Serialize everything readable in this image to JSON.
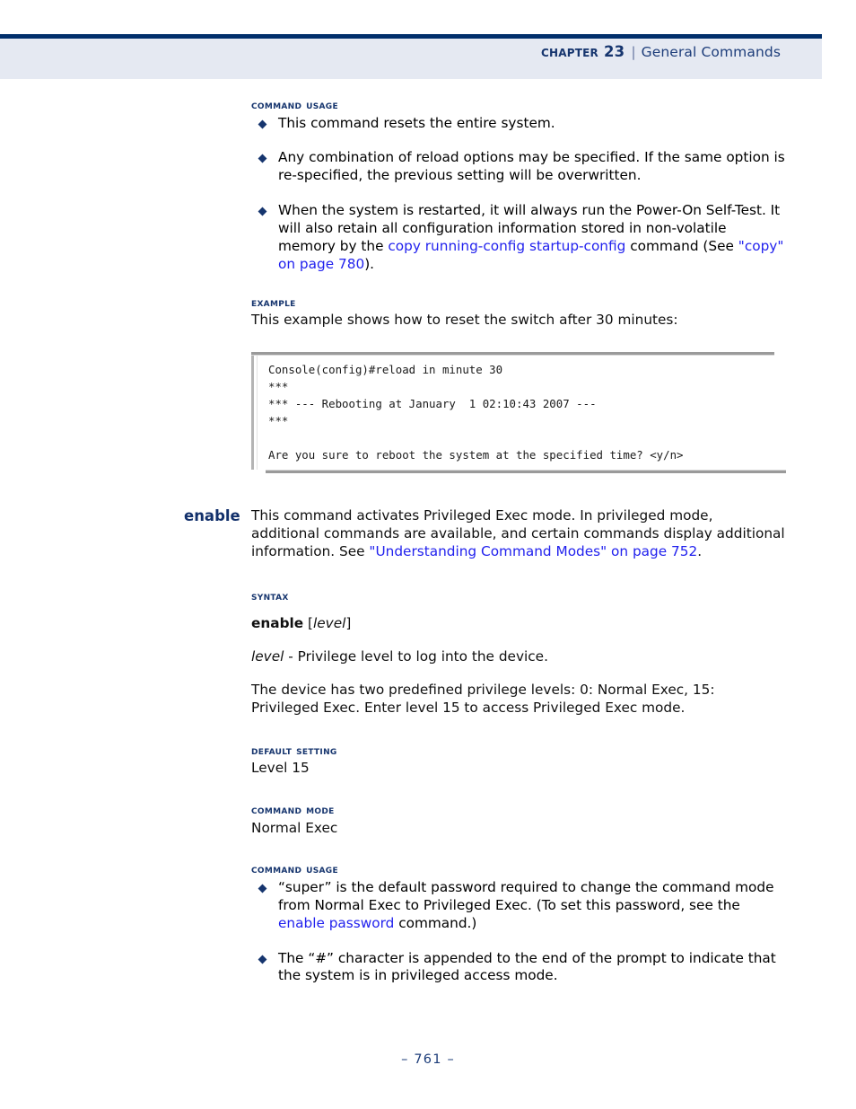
{
  "header": {
    "chapter_label": "Chapter 23",
    "separator": "|",
    "title": "General Commands"
  },
  "sections": {
    "reload": {
      "command_usage_heading": "Command Usage",
      "bullets": [
        {
          "text": "This command resets the entire system."
        },
        {
          "text": "Any combination of reload options may be specified. If the same option is re-specified, the previous setting will be overwritten."
        },
        {
          "lead": "When the system is restarted, it will always run the Power-On Self-Test. It will also retain all configuration information stored in non-volatile memory by the ",
          "link1": "copy running-config startup-config",
          "mid": " command (See ",
          "link2": "\"copy\" on page 780",
          "tail": ")."
        }
      ],
      "example_heading": "Example",
      "example_intro": "This example shows how to reset the switch after 30 minutes:",
      "console_lines": [
        "Console(config)#reload in minute 30",
        "***",
        "*** --- Rebooting at January  1 02:10:43 2007 ---",
        "***",
        "",
        "Are you sure to reboot the system at the specified time? <y/n>"
      ]
    },
    "enable": {
      "command_label": "enable",
      "intro_lead": "This command activates Privileged Exec mode. In privileged mode, additional commands are available, and certain commands display additional information. See ",
      "intro_link": "\"Understanding Command Modes\" on page 752",
      "intro_tail": ".",
      "syntax_heading": "Syntax",
      "syntax_command": "enable",
      "syntax_arg_open": " [",
      "syntax_arg": "level",
      "syntax_arg_close": "]",
      "arg_name": "level",
      "arg_desc": " - Privilege level to log into the device.",
      "arg_note": "The device has two predefined privilege levels: 0: Normal Exec, 15: Privileged Exec. Enter level 15 to access Privileged Exec mode.",
      "default_setting_heading": "Default Setting",
      "default_setting_value": "Level 15",
      "command_mode_heading": "Command Mode",
      "command_mode_value": "Normal Exec",
      "command_usage_heading": "Command Usage",
      "usage_bullets": [
        {
          "lead": "“super” is the default password required to change the command mode from Normal Exec to Privileged Exec. (To set this password, see the ",
          "link": "enable password",
          "tail": " command.)"
        },
        {
          "text": "The “#” character is appended to the end of the prompt to indicate that the system is in privileged access mode."
        }
      ]
    }
  },
  "footer": {
    "page_number": "–  761  –"
  },
  "colors": {
    "header_rule": "#012f6b",
    "header_band": "#e5e9f2",
    "heading_blue": "#16356e",
    "link_blue": "#2222ee",
    "footer_blue": "#1d3d7a"
  }
}
